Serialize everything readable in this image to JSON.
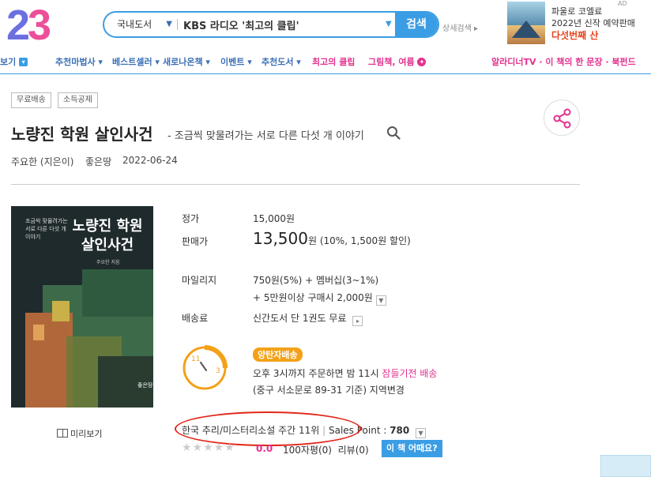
{
  "header": {
    "logo_digit1": "2",
    "logo_digit2": "3",
    "search": {
      "category": "국내도서",
      "query": "KBS 라디오 '최고의 클립'",
      "button": "검색",
      "advanced": "상세검색 ▸"
    },
    "ad": {
      "tag": "AD",
      "line1": "파울로 코엘료",
      "line2": "2022년 신작 예약판매",
      "line3": "다섯번째 산"
    }
  },
  "nav": {
    "first": "보기",
    "items": [
      "추천마법사 ▾",
      "베스트셀러 ▾",
      "새로나온책 ▾",
      "이벤트 ▾",
      "추천도서 ▾",
      "최고의 클립",
      "그림책, 여름"
    ],
    "right": "알라디너TV · 이 책의 한 문장 · 북펀드"
  },
  "product": {
    "tags": [
      "무료배송",
      "소득공제"
    ],
    "title": "노량진 학원 살인사건",
    "subtitle": "- 조금씩 맞물려가는 서로 다른 다섯 개 이야기",
    "author": "주요한 (지은이)",
    "publisher": "좋은땅",
    "date": "2022-06-24",
    "cover": {
      "small_text": "조금씩 맞물려가는 서로 다른 다섯 개 이야기",
      "title_line1": "노량진 학원",
      "title_line2": "살인사건",
      "author": "주요한 지음",
      "publisher": "좋은땅"
    },
    "preview": "미리보기",
    "info": {
      "list_price_label": "정가",
      "list_price": "15,000원",
      "sale_price_label": "판매가",
      "sale_price": "13,500",
      "sale_unit": "원",
      "discount": "(10%, 1,500원 할인)",
      "mileage_label": "마일리지",
      "mileage_line1": "750원(5%) + 멤버십(3~1%)",
      "mileage_line2": "+ 5만원이상 구매시 2,000원",
      "shipping_label": "배송료",
      "shipping": "신간도서 단 1권도 무료",
      "delivery_badge": "양탄자배송",
      "delivery_line1_a": "오후 3시까지 주문하면 밤 11시 ",
      "delivery_line1_b": "잠들기전 배송",
      "delivery_line2": "(중구 서소문로 89-31 기준) 지역변경",
      "clock_left": "11",
      "clock_right": "3"
    },
    "rank": "한국 추리/미스터리소설 주간 11위",
    "sales_point_label": "Sales Point : ",
    "sales_point": "780",
    "rating": {
      "stars_filled": 0,
      "stars_total": 5,
      "score": "0.0",
      "reviews": "100자평(0)",
      "reviews2": "리뷰(0)",
      "button": "이 책 어때요?"
    }
  },
  "colors": {
    "accent_blue": "#3b9de4",
    "nav_blue": "#3b6fb6",
    "pink": "#e2328f",
    "orange": "#f3a118",
    "highlight_red": "#e2261a"
  }
}
